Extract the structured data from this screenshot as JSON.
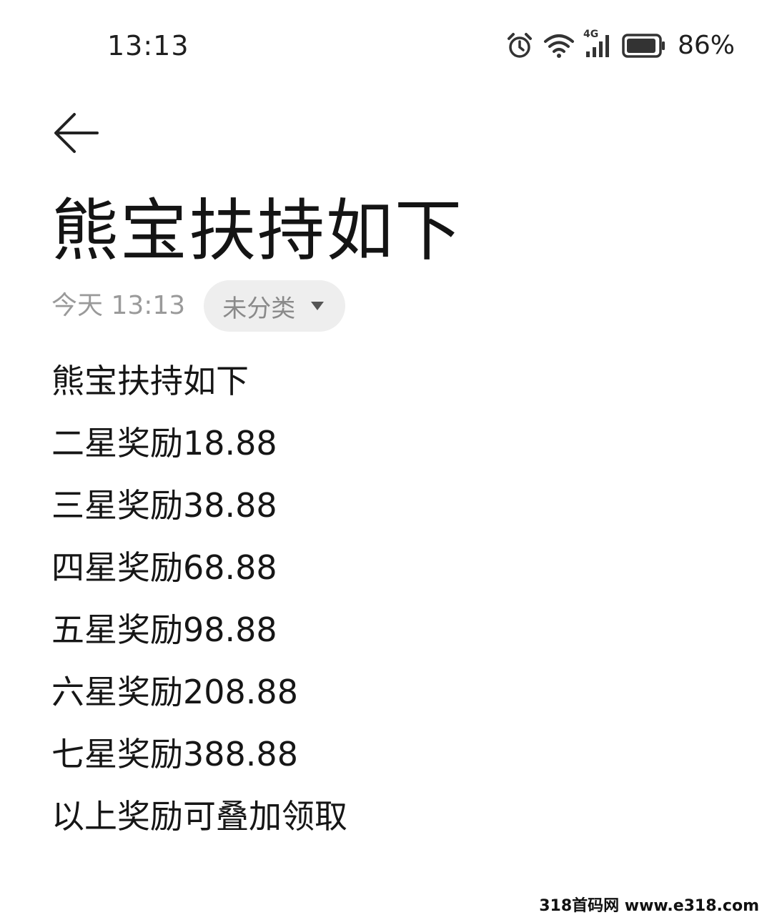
{
  "status_bar": {
    "time": "13:13",
    "network_label": "4G",
    "battery_percent": "86%",
    "icons": [
      "alarm-icon",
      "wifi-icon",
      "signal-icon",
      "battery-icon"
    ]
  },
  "note": {
    "title": "熊宝扶持如下",
    "timestamp": "今天 13:13",
    "category": "未分类",
    "lines": [
      "熊宝扶持如下",
      "二星奖励18.88",
      "三星奖励38.88",
      "四星奖励68.88",
      "五星奖励98.88",
      "六星奖励208.88",
      "七星奖励388.88",
      "以上奖励可叠加领取"
    ]
  },
  "watermark": "318首码网 www.e318.com",
  "colors": {
    "background": "#ffffff",
    "text": "#161616",
    "muted": "#9a9a9a",
    "chip_bg": "#eeeeee"
  }
}
